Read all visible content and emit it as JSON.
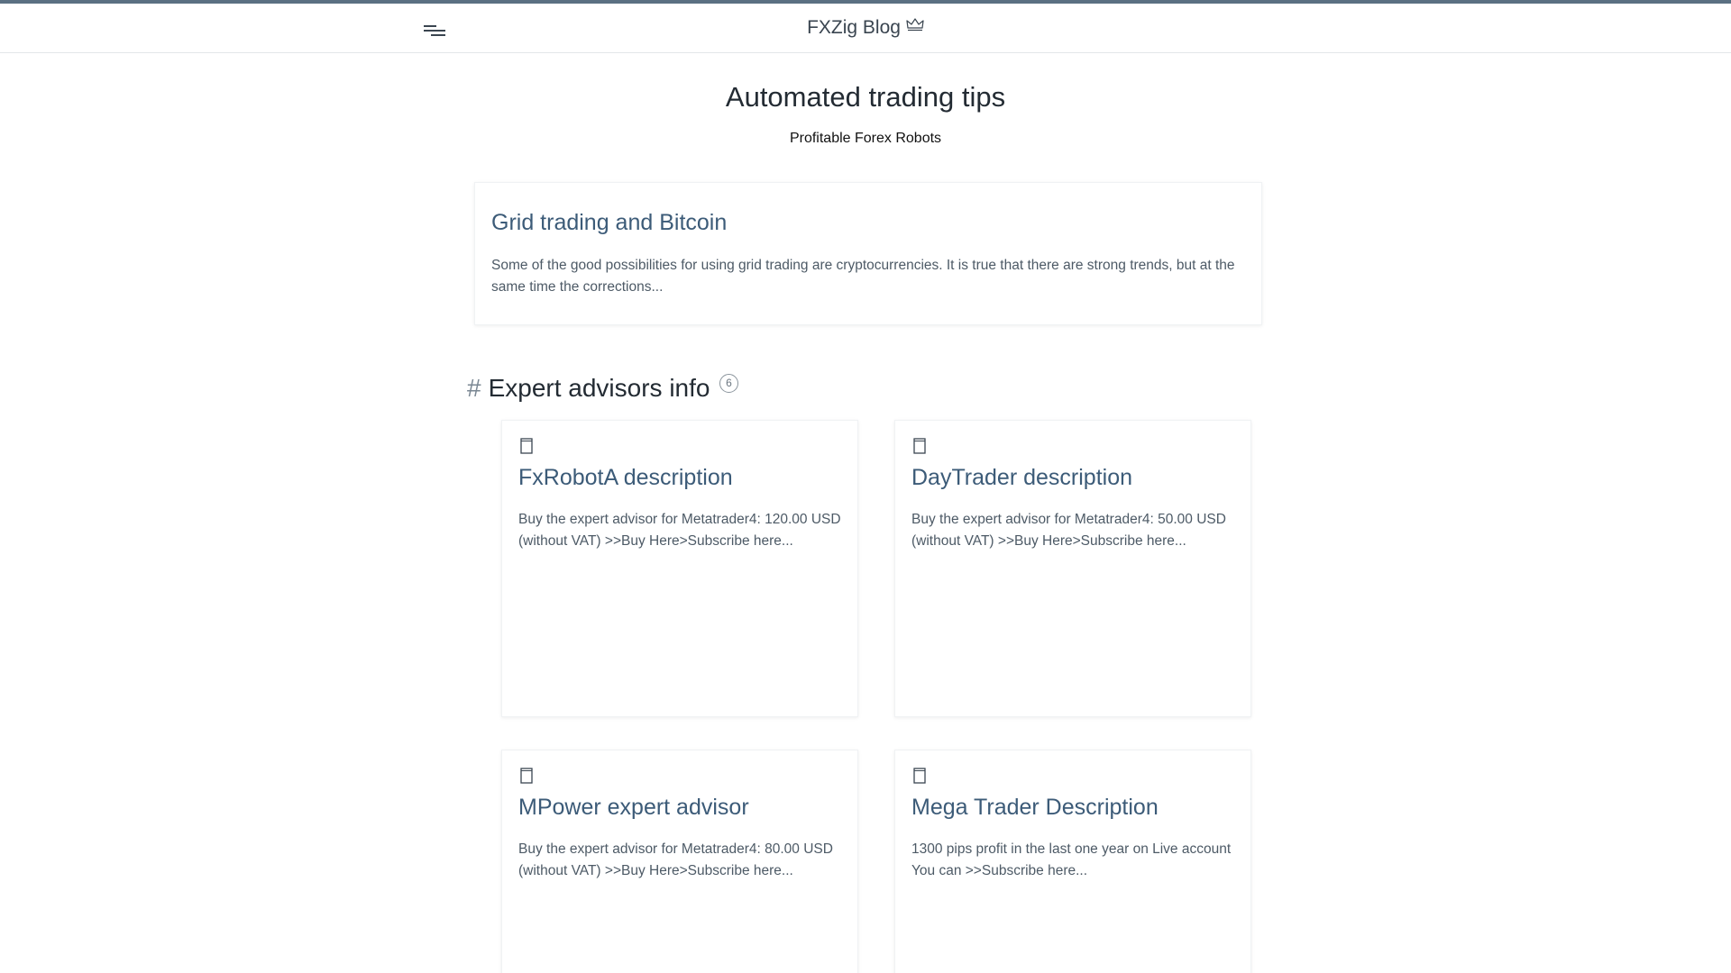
{
  "header": {
    "brand": "FXZig Blog",
    "menu_icon": "hamburger-menu-icon",
    "brand_icon": "crown-icon"
  },
  "hero": {
    "title": "Automated trading tips",
    "subtitle": "Profitable Forex Robots"
  },
  "featured": {
    "title": "Grid trading and Bitcoin",
    "excerpt": "Some of the good possibilities for using grid trading are cryptocurrencies. It is true that there are strong trends, but at the same time the corrections..."
  },
  "section": {
    "hash": "#",
    "title": "Expert advisors info",
    "count": "6"
  },
  "cards": [
    {
      "icon": "document-icon",
      "title": "FxRobotA description",
      "excerpt": "Buy the expert advisor for Metatrader4:  120.00 USD (without VAT)  >>Buy Here>Subscribe here..."
    },
    {
      "icon": "document-icon",
      "title": "DayTrader description",
      "excerpt": "Buy the expert advisor for Metatrader4:  50.00 USD (without VAT)  >>Buy Here>Subscribe here..."
    },
    {
      "icon": "document-icon",
      "title": "MPower expert advisor",
      "excerpt": "Buy the expert advisor for Metatrader4:  80.00 USD (without VAT)  >>Buy Here>Subscribe here..."
    },
    {
      "icon": "document-icon",
      "title": "Mega Trader Description",
      "excerpt": "1300 pips profit in the last one year on Live account You can   >>Subscribe here..."
    }
  ],
  "colors": {
    "accent_bar": "#5b7082",
    "link": "#3c5b78",
    "text": "#4d5a66",
    "heading": "#232b33"
  }
}
